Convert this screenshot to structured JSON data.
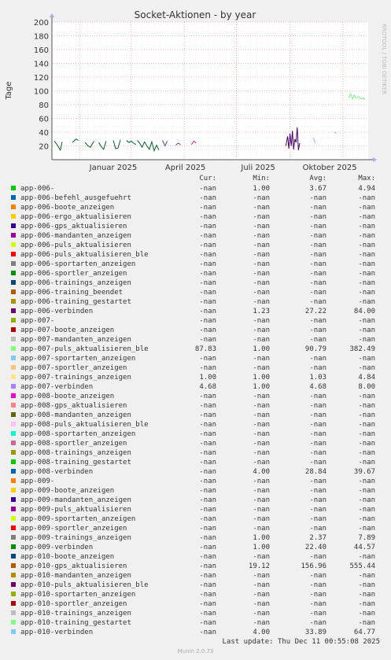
{
  "chart_data": {
    "type": "line",
    "title": "Socket-Aktionen - by year",
    "ylabel": "Tage",
    "ylim": [
      0,
      200
    ],
    "yticks": [
      20,
      40,
      60,
      80,
      100,
      120,
      140,
      160,
      180,
      200
    ],
    "xticks": [
      "Januar 2025",
      "April 2025",
      "Juli 2025",
      "Oktober 2025"
    ],
    "watermark": "RRDTOOL / TOBI OETIKER",
    "colors": {
      "bg": "#f0f0f0",
      "plot": "#ffffff",
      "grid_major": "#e08080",
      "grid_minor": "#e0e0e0",
      "axis": "#555555"
    },
    "series": [
      {
        "name": "app-006-verbinden",
        "color": "#00602a",
        "segments": [
          [
            [
              0.4,
              27
            ],
            [
              1,
              20
            ],
            [
              1.4,
              14
            ],
            [
              1.7,
              26
            ]
          ],
          [
            [
              3.4,
              25
            ],
            [
              4,
              30
            ],
            [
              4.4,
              28
            ]
          ],
          [
            [
              5.5,
              25
            ],
            [
              6,
              20
            ],
            [
              6.4,
              18
            ],
            [
              7,
              27
            ]
          ],
          [
            [
              7.8,
              25
            ],
            [
              8.2,
              19
            ],
            [
              8.6,
              15
            ],
            [
              9,
              27
            ]
          ],
          [
            [
              10.2,
              28
            ],
            [
              10.6,
              16
            ],
            [
              11,
              17
            ],
            [
              11.4,
              29
            ]
          ],
          [
            [
              12.4,
              28
            ],
            [
              12.8,
              25
            ],
            [
              13.2,
              27
            ],
            [
              13.6,
              24
            ],
            [
              14,
              22
            ]
          ],
          [
            [
              14.2,
              28
            ],
            [
              14.6,
              24
            ],
            [
              15,
              18
            ],
            [
              15.4,
              26
            ],
            [
              15.8,
              20
            ],
            [
              16.2,
              15
            ],
            [
              16.6,
              26
            ],
            [
              17,
              13
            ],
            [
              17.4,
              21
            ],
            [
              17.8,
              14
            ]
          ]
        ]
      },
      {
        "name": "app-007-verbinden",
        "color": "#6a3d9a",
        "segments": [
          [
            [
              20.6,
              21
            ],
            [
              21,
              24
            ],
            [
              21.4,
              22
            ]
          ],
          [
            [
              18.4,
              28
            ],
            [
              18.8,
              20
            ],
            [
              19.2,
              27
            ]
          ]
        ]
      },
      {
        "name": "app-008-verbinden",
        "color": "#cc2a80",
        "segments": [
          [
            [
              23.2,
              22
            ],
            [
              23.6,
              27
            ],
            [
              24,
              24
            ]
          ]
        ]
      },
      {
        "name": "app-009-verbinden",
        "color": "#4a0070",
        "segments": [
          [
            [
              38.9,
              20
            ],
            [
              39.2,
              34
            ],
            [
              39.4,
              16
            ],
            [
              39.6,
              38
            ],
            [
              39.8,
              20
            ],
            [
              40,
              42
            ],
            [
              40.2,
              15
            ],
            [
              40.4,
              30
            ],
            [
              40.6,
              25
            ],
            [
              40.8,
              47
            ],
            [
              41,
              14
            ],
            [
              41.2,
              24
            ]
          ]
        ]
      },
      {
        "name": "app-010-verbinden",
        "color": "#80c0e0",
        "segments": [
          [
            [
              43.5,
              32
            ],
            [
              43.8,
              24
            ]
          ],
          [
            [
              47,
              40
            ],
            [
              47.3,
              38
            ]
          ]
        ]
      },
      {
        "name": "app-007-puls_aktualisieren_ble",
        "color": "#88ee88",
        "segments": [
          [
            [
              49.4,
              90
            ],
            [
              49.7,
              96
            ],
            [
              50,
              88
            ],
            [
              50.3,
              94
            ],
            [
              50.6,
              89
            ],
            [
              51,
              92
            ],
            [
              51.4,
              88
            ],
            [
              51.8,
              90
            ],
            [
              52.1,
              87
            ]
          ]
        ]
      }
    ]
  },
  "legend": {
    "headers": {
      "cur": "Cur:",
      "min": "Min:",
      "avg": "Avg:",
      "max": "Max:"
    },
    "rows": [
      {
        "name": "app-006-",
        "color": "#00cc00",
        "cur": "-nan",
        "min": "1.00",
        "avg": "3.67",
        "max": "4.94"
      },
      {
        "name": "app-006-befehl_ausgefuehrt",
        "color": "#0066b3",
        "cur": "-nan",
        "min": "-nan",
        "avg": "-nan",
        "max": "-nan"
      },
      {
        "name": "app-006-boote_anzeigen",
        "color": "#ff8000",
        "cur": "-nan",
        "min": "-nan",
        "avg": "-nan",
        "max": "-nan"
      },
      {
        "name": "app-006-ergo_aktualisieren",
        "color": "#ffcc00",
        "cur": "-nan",
        "min": "-nan",
        "avg": "-nan",
        "max": "-nan"
      },
      {
        "name": "app-006-gps_aktualisieren",
        "color": "#330099",
        "cur": "-nan",
        "min": "-nan",
        "avg": "-nan",
        "max": "-nan"
      },
      {
        "name": "app-006-mandanten_anzeigen",
        "color": "#990099",
        "cur": "-nan",
        "min": "-nan",
        "avg": "-nan",
        "max": "-nan"
      },
      {
        "name": "app-006-puls_aktualisieren",
        "color": "#ccff00",
        "cur": "-nan",
        "min": "-nan",
        "avg": "-nan",
        "max": "-nan"
      },
      {
        "name": "app-006-puls_aktualisieren_ble",
        "color": "#ff0000",
        "cur": "-nan",
        "min": "-nan",
        "avg": "-nan",
        "max": "-nan"
      },
      {
        "name": "app-006-sportarten_anzeigen",
        "color": "#808080",
        "cur": "-nan",
        "min": "-nan",
        "avg": "-nan",
        "max": "-nan"
      },
      {
        "name": "app-006-sportler_anzeigen",
        "color": "#008f00",
        "cur": "-nan",
        "min": "-nan",
        "avg": "-nan",
        "max": "-nan"
      },
      {
        "name": "app-006-trainings_anzeigen",
        "color": "#00487d",
        "cur": "-nan",
        "min": "-nan",
        "avg": "-nan",
        "max": "-nan"
      },
      {
        "name": "app-006-training_beendet",
        "color": "#b35a00",
        "cur": "-nan",
        "min": "-nan",
        "avg": "-nan",
        "max": "-nan"
      },
      {
        "name": "app-006-training_gestartet",
        "color": "#b38f00",
        "cur": "-nan",
        "min": "-nan",
        "avg": "-nan",
        "max": "-nan"
      },
      {
        "name": "app-006-verbinden",
        "color": "#6b006b",
        "cur": "-nan",
        "min": "1.23",
        "avg": "27.22",
        "max": "84.00"
      },
      {
        "name": "app-007-",
        "color": "#8fb300",
        "cur": "-nan",
        "min": "-nan",
        "avg": "-nan",
        "max": "-nan"
      },
      {
        "name": "app-007-boote_anzeigen",
        "color": "#b30000",
        "cur": "-nan",
        "min": "-nan",
        "avg": "-nan",
        "max": "-nan"
      },
      {
        "name": "app-007-mandanten_anzeigen",
        "color": "#bebebe",
        "cur": "-nan",
        "min": "-nan",
        "avg": "-nan",
        "max": "-nan"
      },
      {
        "name": "app-007-puls_aktualisieren_ble",
        "color": "#80ff80",
        "cur": "87.83",
        "min": "1.00",
        "avg": "90.79",
        "max": "382.49"
      },
      {
        "name": "app-007-sportarten_anzeigen",
        "color": "#80c9ff",
        "cur": "-nan",
        "min": "-nan",
        "avg": "-nan",
        "max": "-nan"
      },
      {
        "name": "app-007-sportler_anzeigen",
        "color": "#ffc080",
        "cur": "-nan",
        "min": "-nan",
        "avg": "-nan",
        "max": "-nan"
      },
      {
        "name": "app-007-trainings_anzeigen",
        "color": "#ffe680",
        "cur": "1.00",
        "min": "1.00",
        "avg": "1.03",
        "max": "4.84"
      },
      {
        "name": "app-007-verbinden",
        "color": "#aa80ff",
        "cur": "4.68",
        "min": "1.00",
        "avg": "4.68",
        "max": "8.00"
      },
      {
        "name": "app-008-boote_anzeigen",
        "color": "#ee00cc",
        "cur": "-nan",
        "min": "-nan",
        "avg": "-nan",
        "max": "-nan"
      },
      {
        "name": "app-008-gps_aktualisieren",
        "color": "#ff8080",
        "cur": "-nan",
        "min": "-nan",
        "avg": "-nan",
        "max": "-nan"
      },
      {
        "name": "app-008-mandanten_anzeigen",
        "color": "#666600",
        "cur": "-nan",
        "min": "-nan",
        "avg": "-nan",
        "max": "-nan"
      },
      {
        "name": "app-008-puls_aktualisieren_ble",
        "color": "#ffbfff",
        "cur": "-nan",
        "min": "-nan",
        "avg": "-nan",
        "max": "-nan"
      },
      {
        "name": "app-008-sportarten_anzeigen",
        "color": "#00ffcc",
        "cur": "-nan",
        "min": "-nan",
        "avg": "-nan",
        "max": "-nan"
      },
      {
        "name": "app-008-sportler_anzeigen",
        "color": "#cc6699",
        "cur": "-nan",
        "min": "-nan",
        "avg": "-nan",
        "max": "-nan"
      },
      {
        "name": "app-008-trainings_anzeigen",
        "color": "#999900",
        "cur": "-nan",
        "min": "-nan",
        "avg": "-nan",
        "max": "-nan"
      },
      {
        "name": "app-008-training_gestartet",
        "color": "#00cc00",
        "cur": "-nan",
        "min": "-nan",
        "avg": "-nan",
        "max": "-nan"
      },
      {
        "name": "app-008-verbinden",
        "color": "#0066b3",
        "cur": "-nan",
        "min": "4.00",
        "avg": "28.84",
        "max": "39.67"
      },
      {
        "name": "app-009-",
        "color": "#ff8000",
        "cur": "-nan",
        "min": "-nan",
        "avg": "-nan",
        "max": "-nan"
      },
      {
        "name": "app-009-boote_anzeigen",
        "color": "#ffcc00",
        "cur": "-nan",
        "min": "-nan",
        "avg": "-nan",
        "max": "-nan"
      },
      {
        "name": "app-009-mandanten_anzeigen",
        "color": "#330099",
        "cur": "-nan",
        "min": "-nan",
        "avg": "-nan",
        "max": "-nan"
      },
      {
        "name": "app-009-puls_aktualisieren",
        "color": "#990099",
        "cur": "-nan",
        "min": "-nan",
        "avg": "-nan",
        "max": "-nan"
      },
      {
        "name": "app-009-sportarten_anzeigen",
        "color": "#ccff00",
        "cur": "-nan",
        "min": "-nan",
        "avg": "-nan",
        "max": "-nan"
      },
      {
        "name": "app-009-sportler_anzeigen",
        "color": "#ff0000",
        "cur": "-nan",
        "min": "-nan",
        "avg": "-nan",
        "max": "-nan"
      },
      {
        "name": "app-009-trainings_anzeigen",
        "color": "#808080",
        "cur": "-nan",
        "min": "1.00",
        "avg": "2.37",
        "max": "7.89"
      },
      {
        "name": "app-009-verbinden",
        "color": "#008f00",
        "cur": "-nan",
        "min": "1.00",
        "avg": "22.40",
        "max": "44.57"
      },
      {
        "name": "app-010-boote_anzeigen",
        "color": "#00487d",
        "cur": "-nan",
        "min": "-nan",
        "avg": "-nan",
        "max": "-nan"
      },
      {
        "name": "app-010-gps_aktualisieren",
        "color": "#b35a00",
        "cur": "-nan",
        "min": "19.12",
        "avg": "156.96",
        "max": "555.44"
      },
      {
        "name": "app-010-mandanten_anzeigen",
        "color": "#b38f00",
        "cur": "-nan",
        "min": "-nan",
        "avg": "-nan",
        "max": "-nan"
      },
      {
        "name": "app-010-puls_aktualisieren_ble",
        "color": "#6b006b",
        "cur": "-nan",
        "min": "-nan",
        "avg": "-nan",
        "max": "-nan"
      },
      {
        "name": "app-010-sportarten_anzeigen",
        "color": "#8fb300",
        "cur": "-nan",
        "min": "-nan",
        "avg": "-nan",
        "max": "-nan"
      },
      {
        "name": "app-010-sportler_anzeigen",
        "color": "#b30000",
        "cur": "-nan",
        "min": "-nan",
        "avg": "-nan",
        "max": "-nan"
      },
      {
        "name": "app-010-trainings_anzeigen",
        "color": "#bebebe",
        "cur": "-nan",
        "min": "-nan",
        "avg": "-nan",
        "max": "-nan"
      },
      {
        "name": "app-010-training_gestartet",
        "color": "#80ff80",
        "cur": "-nan",
        "min": "-nan",
        "avg": "-nan",
        "max": "-nan"
      },
      {
        "name": "app-010-verbinden",
        "color": "#80c9ff",
        "cur": "-nan",
        "min": "4.00",
        "avg": "33.89",
        "max": "64.77"
      }
    ]
  },
  "footer": {
    "last_update": "Last update: Thu Dec 11 00:55:08 2025",
    "munin_version": "Munin 2.0.73"
  }
}
